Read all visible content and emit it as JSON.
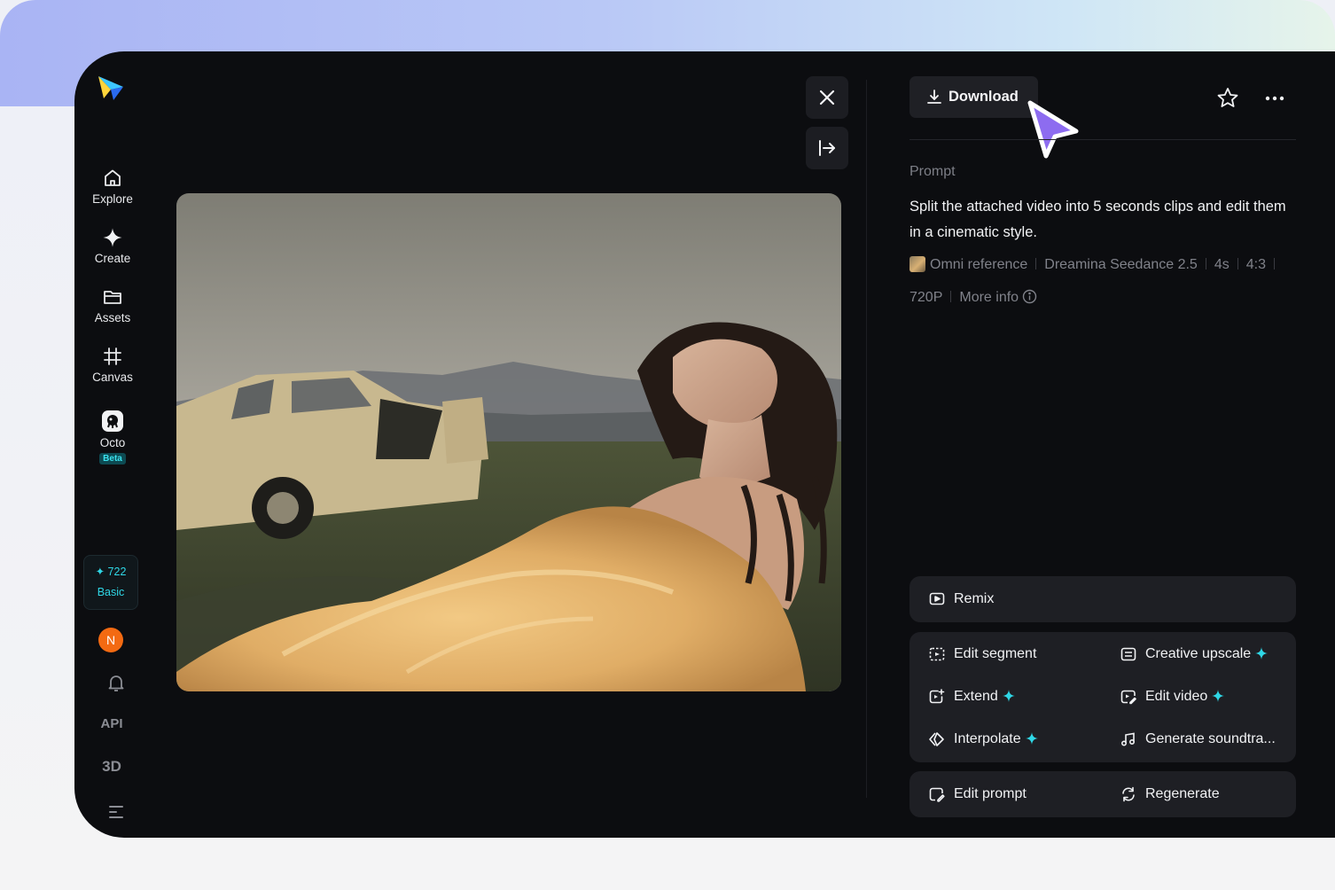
{
  "sidebar": {
    "items": [
      {
        "label": "Explore",
        "icon": "home-icon"
      },
      {
        "label": "Create",
        "icon": "sparkle-icon"
      },
      {
        "label": "Assets",
        "icon": "folder-icon"
      },
      {
        "label": "Canvas",
        "icon": "canvas-icon"
      },
      {
        "label": "Octo",
        "icon": "octo-icon",
        "badge": "Beta"
      }
    ],
    "credits": {
      "count": "722",
      "plan": "Basic"
    },
    "avatar_initial": "N",
    "api_label": "API",
    "three_d_label": "3D"
  },
  "toolbar": {
    "download_label": "Download"
  },
  "detail": {
    "prompt_label": "Prompt",
    "prompt_text": "Split the attached video into 5 seconds clips and edit them in a cinematic style.",
    "meta": {
      "reference": "Omni reference",
      "model": "Dreamina Seedance 2.5",
      "duration": "4s",
      "ratio": "4:3",
      "resolution": "720P",
      "more_info": "More info"
    }
  },
  "actions": {
    "remix": "Remix",
    "edit_segment": "Edit segment",
    "creative_upscale": "Creative upscale",
    "extend": "Extend",
    "edit_video": "Edit video",
    "interpolate": "Interpolate",
    "generate_soundtrack": "Generate soundtra...",
    "edit_prompt": "Edit prompt",
    "regenerate": "Regenerate"
  },
  "colors": {
    "accent": "#2fd7e6",
    "cursor": "#8d6cf0",
    "avatar": "#f36a12",
    "window_bg": "#0c0d10",
    "panel_bg": "#1e1f24"
  }
}
